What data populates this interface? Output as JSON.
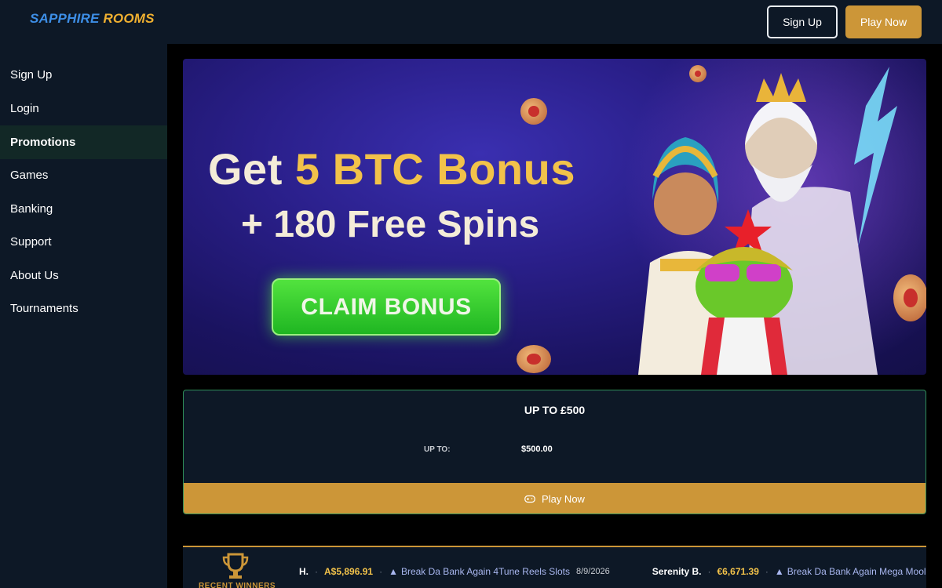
{
  "brand": {
    "name_part1": "SAPPHIRE",
    "name_part2": "ROOMS"
  },
  "header": {
    "signup_label": "Sign Up",
    "play_label": "Play Now"
  },
  "sidebar": {
    "items": [
      {
        "label": "Sign Up"
      },
      {
        "label": "Login"
      },
      {
        "label": "Promotions",
        "active": true
      },
      {
        "label": "Games"
      },
      {
        "label": "Banking"
      },
      {
        "label": "Support"
      },
      {
        "label": "About Us"
      },
      {
        "label": "Tournaments"
      }
    ]
  },
  "banner": {
    "line1_prefix": "Get ",
    "line1_highlight": "5 BTC Bonus",
    "line2": "+ 180 Free Spins",
    "cta": "CLAIM BONUS"
  },
  "offer": {
    "title": "UP TO £500",
    "label": "UP TO:",
    "value": "$500.00",
    "play_label": "Play Now"
  },
  "winners": {
    "label": "RECENT WINNERS",
    "entries": [
      {
        "name": "H.",
        "amount": "A$5,896.91",
        "game": "Break Da Bank Again 4Tune Reels Slots",
        "date": "8/9/2026"
      },
      {
        "name": "Serenity B.",
        "amount": "€6,671.39",
        "game": "Break Da Bank Again Mega Moolah",
        "date": ""
      }
    ]
  },
  "colors": {
    "accent_gold": "#cc9638",
    "panel": "#0d1826",
    "green_cta": "#2fc92a"
  }
}
